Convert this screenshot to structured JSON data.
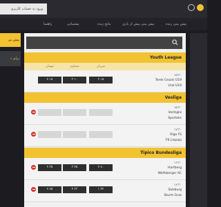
{
  "topbar": {
    "login_label": "ورود به حساب کاربری"
  },
  "nav": [
    "پیش بینی زنده",
    "پیش بینی پیش از بازی",
    "نتایج زنده",
    "پشتیبانی",
    "راهنما"
  ],
  "sidebar": {
    "item1": "پیش بی",
    "item2": "برای د"
  },
  "search": {
    "placeholder": ""
  },
  "odds_labels": [
    "میزبان",
    "مساوی",
    "مهمان"
  ],
  "leagues": [
    {
      "name": "Youth League",
      "matches": [
        {
          "time": "۱۵:۳۰",
          "team1": "Terek Grozni U19",
          "team2": "Ural U19",
          "odds": [
            "۲.۱۵",
            "۳.۱۰",
            "۳.۱۵"
          ]
        }
      ]
    },
    {
      "name": "Vesliga",
      "matches": [
        {
          "time": "۱۵:۳۰",
          "team1": "Veritiglis",
          "team2": "Spartaks",
          "odds": [
            "",
            "",
            ""
          ]
        },
        {
          "time": "۱۷:۳۰",
          "team1": "Riga FS",
          "team2": "FK Liepaja",
          "odds": [
            "",
            "",
            ""
          ]
        }
      ]
    },
    {
      "name": "Tipico Bundesliga",
      "matches": [
        {
          "time": "۱۶:۳۰",
          "team1": "Hartberg",
          "team2": "Wolfsberger AC",
          "odds": [
            "۲.۸۰",
            "۳.۴۵",
            "۲.۳۵"
          ]
        },
        {
          "time": "۱۶:۳۰",
          "team1": "Salzburg",
          "team2": "Sturm Graz",
          "odds": [
            "۱.۴۴",
            "۴.۳۳",
            "۲.۷۵"
          ]
        }
      ]
    }
  ]
}
